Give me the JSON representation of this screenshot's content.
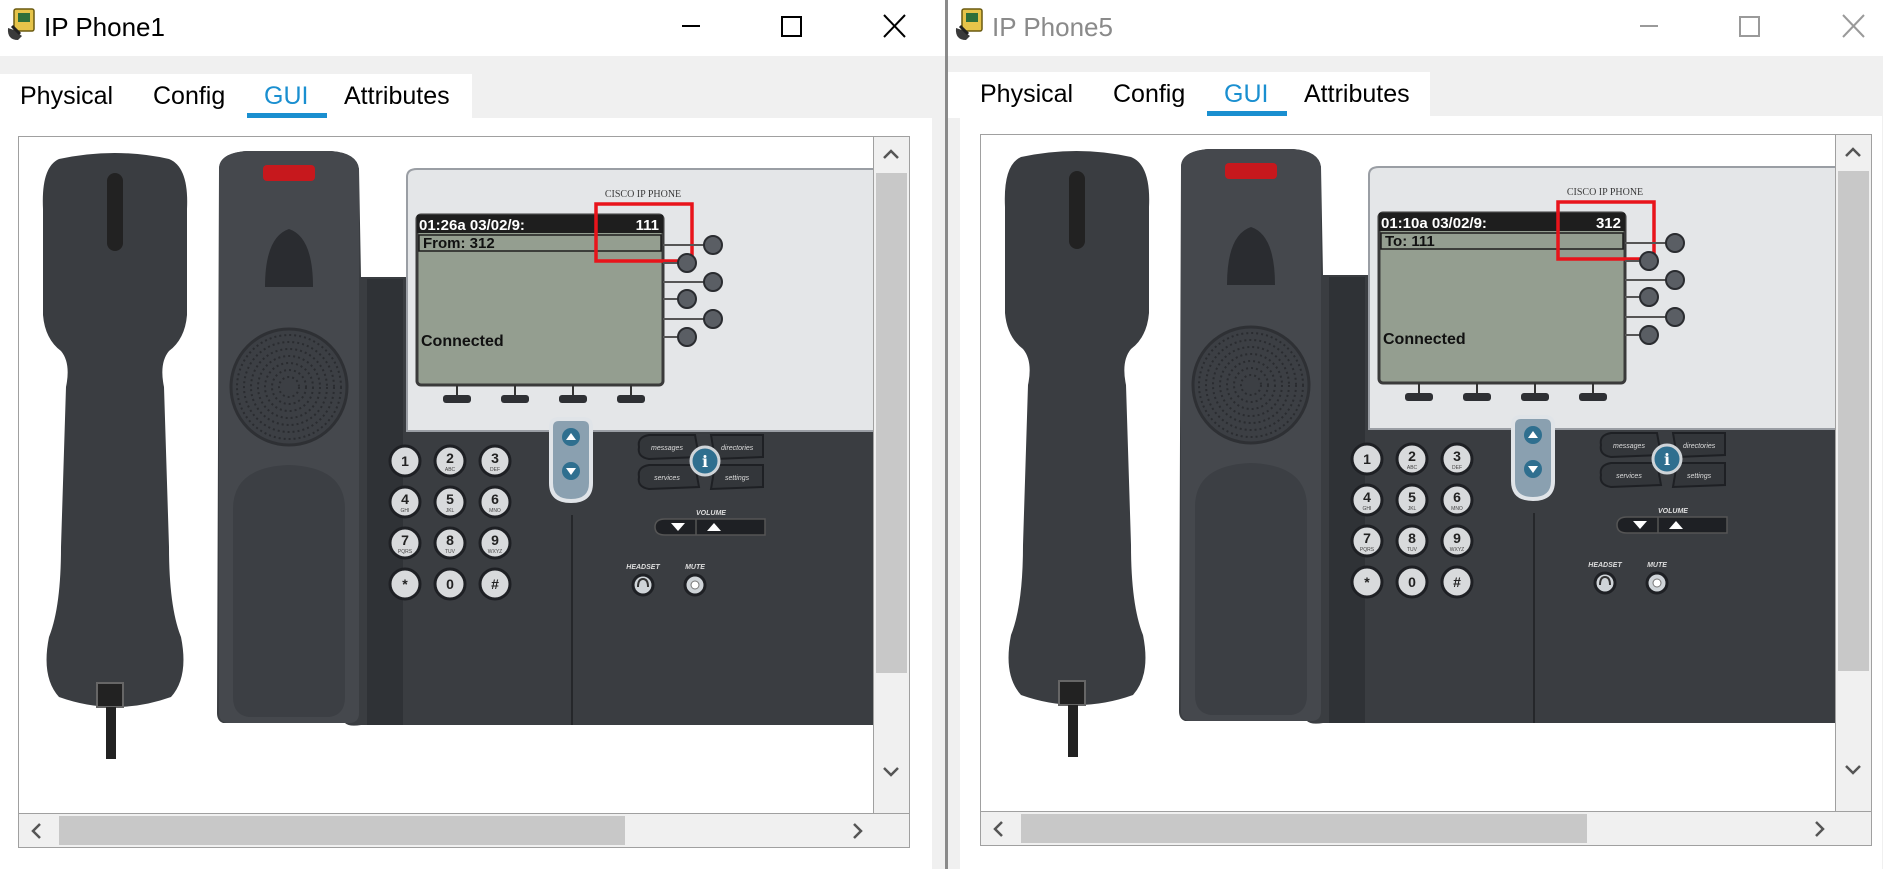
{
  "windows": [
    {
      "title": "IP Phone1",
      "active": true,
      "tabs": [
        "Physical",
        "Config",
        "GUI",
        "Attributes"
      ],
      "active_tab": "GUI",
      "phone": {
        "datetime": "01:26a 03/02/9:",
        "extension": "111",
        "call_line": "From: 312",
        "status": "Connected",
        "brand": "CISCO IP PHONE"
      }
    },
    {
      "title": "IP Phone5",
      "active": false,
      "tabs": [
        "Physical",
        "Config",
        "GUI",
        "Attributes"
      ],
      "active_tab": "GUI",
      "phone": {
        "datetime": "01:10a 03/02/9:",
        "extension": "312",
        "call_line": "To: 111",
        "status": "Connected",
        "brand": "CISCO IP PHONE"
      }
    }
  ],
  "keypad": [
    {
      "digit": "1",
      "letters": ""
    },
    {
      "digit": "2",
      "letters": "ABC"
    },
    {
      "digit": "3",
      "letters": "DEF"
    },
    {
      "digit": "4",
      "letters": "GHI"
    },
    {
      "digit": "5",
      "letters": "JKL"
    },
    {
      "digit": "6",
      "letters": "MNO"
    },
    {
      "digit": "7",
      "letters": "PQRS"
    },
    {
      "digit": "8",
      "letters": "TUV"
    },
    {
      "digit": "9",
      "letters": "WXYZ"
    },
    {
      "digit": "*",
      "letters": ""
    },
    {
      "digit": "0",
      "letters": ""
    },
    {
      "digit": "#",
      "letters": ""
    }
  ],
  "phone_buttons": {
    "messages": "messages",
    "directories": "directories",
    "services": "services",
    "settings": "settings",
    "volume": "VOLUME",
    "headset": "HEADSET",
    "mute": "MUTE",
    "info": "i"
  },
  "colors": {
    "accent": "#1a8fd0",
    "highlight_box": "#e8141b",
    "lcd": "#949e90",
    "phone_body": "#3a3d41"
  },
  "icons": {
    "window_icon": "packet-tracer-phone-icon",
    "minimize": "minimize-icon",
    "maximize": "maximize-icon",
    "close": "close-icon"
  }
}
